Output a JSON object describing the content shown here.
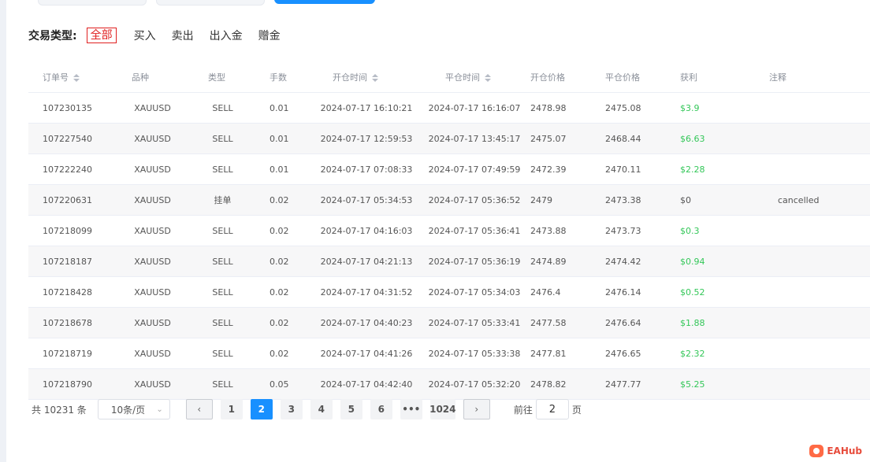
{
  "filter": {
    "label": "交易类型:",
    "options": [
      "全部",
      "买入",
      "卖出",
      "出入金",
      "赠金"
    ],
    "active": "全部"
  },
  "table": {
    "columns": [
      "订单号",
      "品种",
      "类型",
      "手数",
      "开仓时间",
      "平仓时间",
      "开仓价格",
      "平仓价格",
      "获利",
      "注释"
    ],
    "rows": [
      [
        "107230135",
        "XAUUSD",
        "SELL",
        "0.01",
        "2024-07-17 16:10:21",
        "2024-07-17 16:16:07",
        "2478.98",
        "2475.08",
        "$3.9",
        ""
      ],
      [
        "107227540",
        "XAUUSD",
        "SELL",
        "0.01",
        "2024-07-17 12:59:53",
        "2024-07-17 13:45:17",
        "2475.07",
        "2468.44",
        "$6.63",
        ""
      ],
      [
        "107222240",
        "XAUUSD",
        "SELL",
        "0.01",
        "2024-07-17 07:08:33",
        "2024-07-17 07:49:59",
        "2472.39",
        "2470.11",
        "$2.28",
        ""
      ],
      [
        "107220631",
        "XAUUSD",
        "挂单",
        "0.02",
        "2024-07-17 05:34:53",
        "2024-07-17 05:36:52",
        "2479",
        "2473.38",
        "$0",
        "cancelled"
      ],
      [
        "107218099",
        "XAUUSD",
        "SELL",
        "0.02",
        "2024-07-17 04:16:03",
        "2024-07-17 05:36:41",
        "2473.88",
        "2473.73",
        "$0.3",
        ""
      ],
      [
        "107218187",
        "XAUUSD",
        "SELL",
        "0.02",
        "2024-07-17 04:21:13",
        "2024-07-17 05:36:19",
        "2474.89",
        "2474.42",
        "$0.94",
        ""
      ],
      [
        "107218428",
        "XAUUSD",
        "SELL",
        "0.02",
        "2024-07-17 04:31:52",
        "2024-07-17 05:34:03",
        "2476.4",
        "2476.14",
        "$0.52",
        ""
      ],
      [
        "107218678",
        "XAUUSD",
        "SELL",
        "0.02",
        "2024-07-17 04:40:23",
        "2024-07-17 05:33:41",
        "2477.58",
        "2476.64",
        "$1.88",
        ""
      ],
      [
        "107218719",
        "XAUUSD",
        "SELL",
        "0.02",
        "2024-07-17 04:41:26",
        "2024-07-17 05:33:38",
        "2477.81",
        "2476.65",
        "$2.32",
        ""
      ],
      [
        "107218790",
        "XAUUSD",
        "SELL",
        "0.05",
        "2024-07-17 04:42:40",
        "2024-07-17 05:32:20",
        "2478.82",
        "2477.77",
        "$5.25",
        ""
      ]
    ]
  },
  "pagination": {
    "total": "共 10231 条",
    "page_size": "10条/页",
    "prev_icon": "chevron-left-icon",
    "next_icon": "chevron-right-icon",
    "pages": [
      "1",
      "2",
      "3",
      "4",
      "5",
      "6",
      "•••",
      "1024"
    ],
    "current": "2",
    "goto_prefix": "前往",
    "goto_value": "2",
    "goto_suffix": "页"
  },
  "watermark": {
    "text": "EAHub"
  },
  "colors": {
    "accent": "#1890ff",
    "profit": "#34c759",
    "active_filter": "#e02020"
  }
}
